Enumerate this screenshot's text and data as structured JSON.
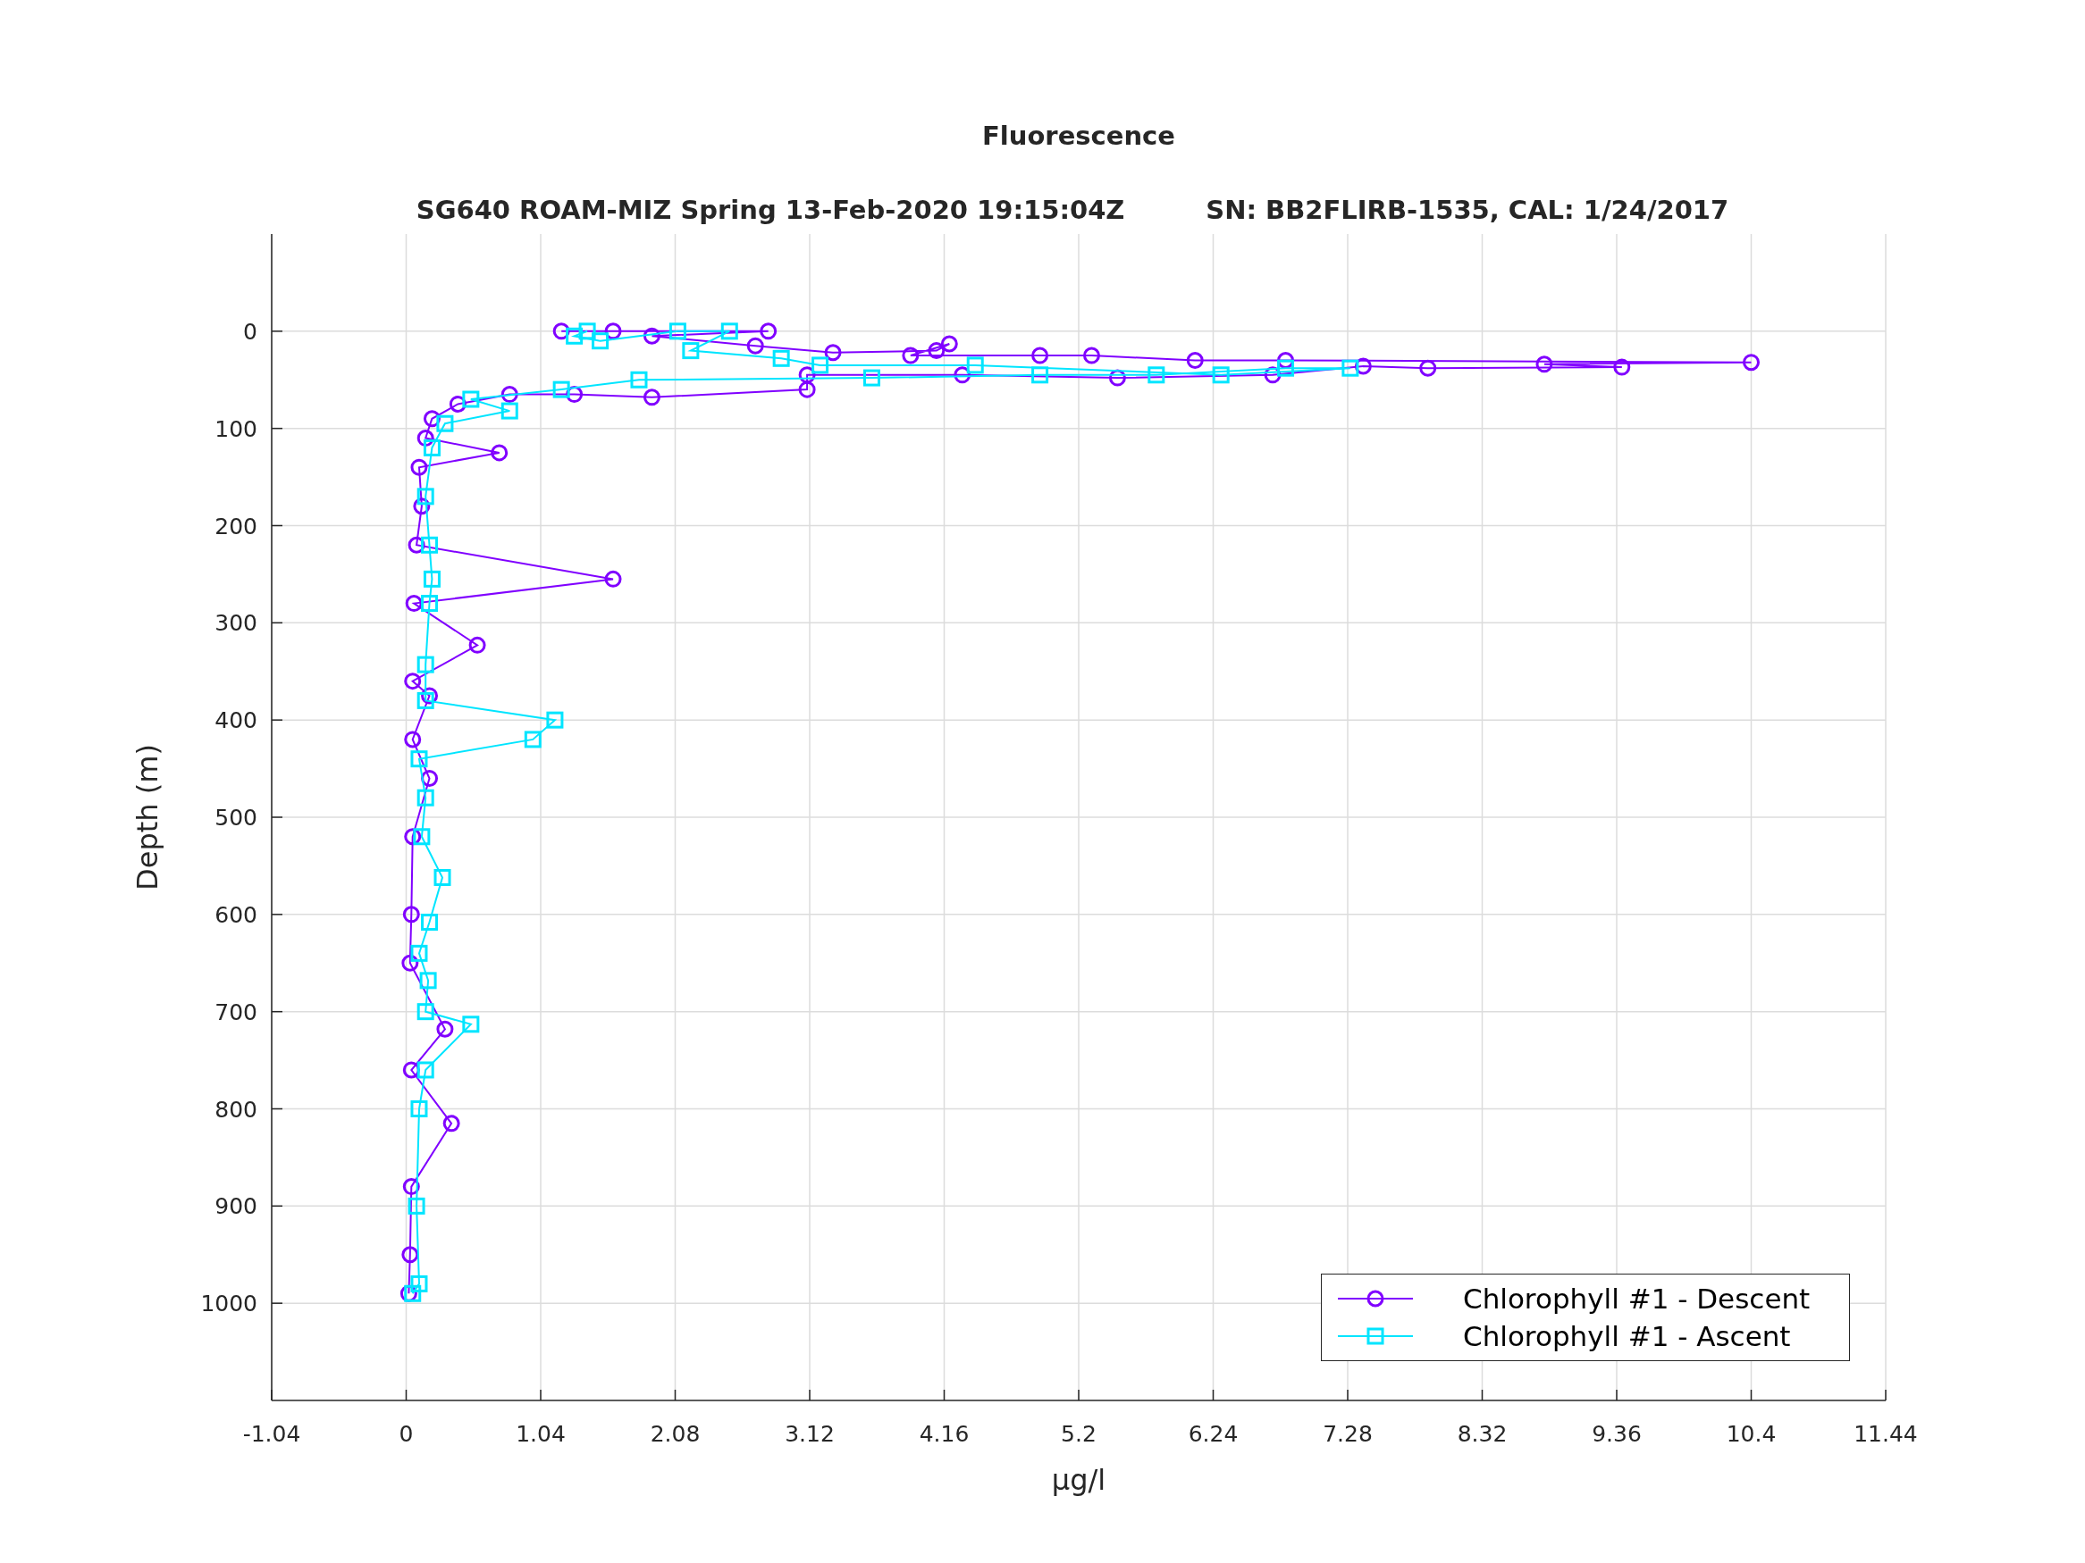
{
  "figure": {
    "title": "Fluorescence",
    "subtitle": "SG640 ROAM-MIZ Spring 13-Feb-2020 19:15:04Z         SN: BB2FLIRB-1535, CAL: 1/24/2017",
    "chart_data": {
      "type": "line",
      "grid": true,
      "xlabel": "µg/l",
      "ylabel": "Depth (m)",
      "xlim": [
        -1.04,
        11.44
      ],
      "ylim": [
        1100,
        -100
      ],
      "xticks": [
        -1.04,
        0,
        1.04,
        2.08,
        3.12,
        4.16,
        5.2,
        6.24,
        7.28,
        8.32,
        9.36,
        10.4,
        11.44
      ],
      "yticks": [
        0,
        100,
        200,
        300,
        400,
        500,
        600,
        700,
        800,
        900,
        1000
      ],
      "series": [
        {
          "name": "Chlorophyll #1 - Descent",
          "color": "#8000ff",
          "marker": "circle",
          "x": [
            1.2,
            1.6,
            2.8,
            1.9,
            2.7,
            3.3,
            4.1,
            4.2,
            3.9,
            4.9,
            5.3,
            6.1,
            6.8,
            10.4,
            8.8,
            9.4,
            7.9,
            7.4,
            6.7,
            5.5,
            4.3,
            3.1,
            3.1,
            1.9,
            1.3,
            0.8,
            0.4,
            0.2,
            0.15,
            0.72,
            0.1,
            0.12,
            0.08,
            1.6,
            0.06,
            0.55,
            0.05,
            0.18,
            0.05,
            0.18,
            0.05,
            0.04,
            0.03,
            0.3,
            0.04,
            0.35,
            0.04,
            0.03,
            0.02
          ],
          "values": [
            0,
            0,
            0,
            5,
            15,
            22,
            20,
            13,
            25,
            25,
            25,
            30,
            30,
            32,
            34,
            37,
            38,
            36,
            45,
            48,
            45,
            45,
            60,
            68,
            65,
            65,
            75,
            90,
            110,
            125,
            140,
            180,
            220,
            255,
            280,
            323,
            360,
            375,
            420,
            460,
            520,
            600,
            650,
            718,
            760,
            815,
            880,
            950,
            990
          ]
        },
        {
          "name": "Chlorophyll #1 - Ascent",
          "color": "#00e5ff",
          "marker": "square",
          "x": [
            0.05,
            0.1,
            0.08,
            0.1,
            0.15,
            0.5,
            0.15,
            0.17,
            0.1,
            0.18,
            0.28,
            0.12,
            0.15,
            0.1,
            0.98,
            1.15,
            0.15,
            0.15,
            0.18,
            0.2,
            0.18,
            0.15,
            0.2,
            0.3,
            0.8,
            0.5,
            1.2,
            1.8,
            3.6,
            4.9,
            5.8,
            6.8,
            7.3,
            6.3,
            4.4,
            3.2,
            2.9,
            2.2,
            2.5,
            2.1,
            1.5,
            1.3,
            1.4
          ],
          "values": [
            990,
            980,
            900,
            800,
            760,
            713,
            700,
            668,
            640,
            608,
            562,
            520,
            480,
            440,
            420,
            400,
            380,
            343,
            280,
            255,
            220,
            170,
            120,
            95,
            82,
            70,
            60,
            50,
            48,
            45,
            45,
            38,
            38,
            45,
            35,
            35,
            28,
            20,
            0,
            0,
            10,
            5,
            0
          ]
        }
      ]
    }
  }
}
